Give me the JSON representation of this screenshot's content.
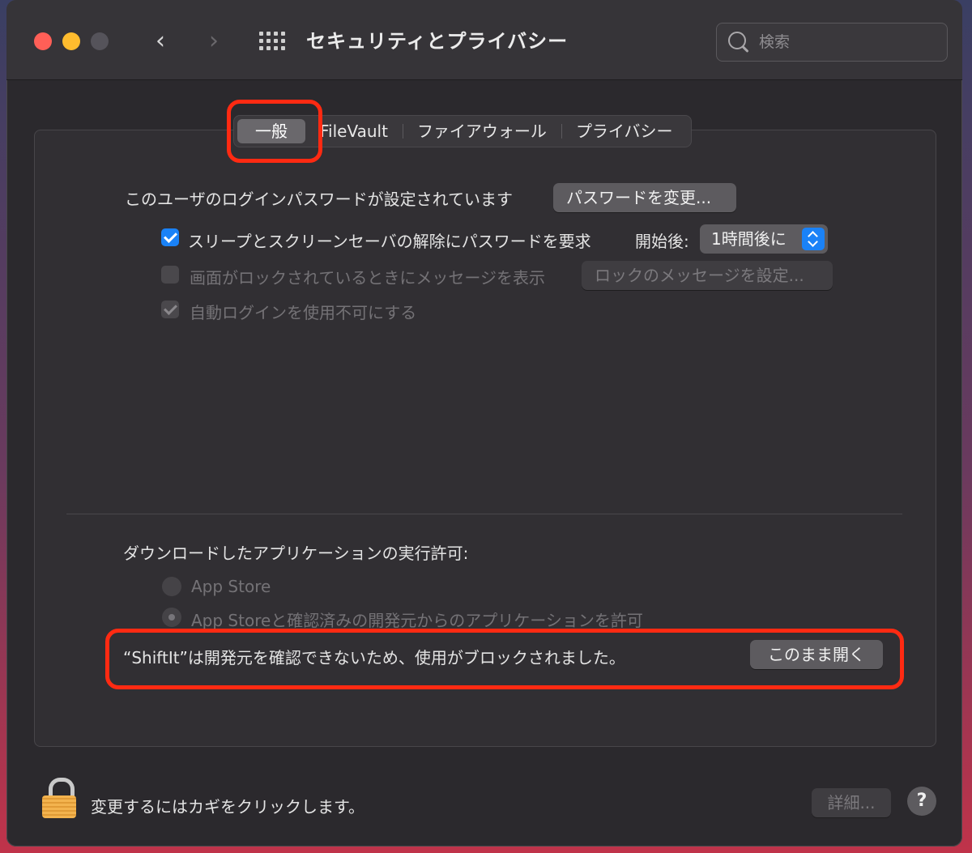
{
  "window": {
    "title": "セキュリティとプライバシー",
    "search_placeholder": "検索"
  },
  "tabs": [
    {
      "label": "一般",
      "selected": true
    },
    {
      "label": "FileVault",
      "selected": false
    },
    {
      "label": "ファイアウォール",
      "selected": false
    },
    {
      "label": "プライバシー",
      "selected": false
    }
  ],
  "general": {
    "password_set_text": "このユーザのログインパスワードが設定されています",
    "change_password_button": "パスワードを変更...",
    "require_password": {
      "label": "スリープとスクリーンセーバの解除にパスワードを要求",
      "checked": true,
      "after_label": "開始後:",
      "after_value": "1時間後に"
    },
    "show_message": {
      "label": "画面がロックされているときにメッセージを表示",
      "checked": false,
      "enabled": false,
      "button": "ロックのメッセージを設定..."
    },
    "disable_auto_login": {
      "label": "自動ログインを使用不可にする",
      "checked": true,
      "enabled": false
    }
  },
  "downloads": {
    "heading": "ダウンロードしたアプリケーションの実行許可:",
    "options": [
      {
        "label": "App Store",
        "selected": false
      },
      {
        "label": "App Storeと確認済みの開発元からのアプリケーションを許可",
        "selected": true
      }
    ],
    "blocked_message": "“ShiftIt”は開発元を確認できないため、使用がブロックされました。",
    "open_anyway_button": "このまま開く"
  },
  "footer": {
    "lock_text": "変更するにはカギをクリックします。",
    "advanced_button": "詳細...",
    "help_label": "?"
  },
  "highlight_color": "#ff2a12",
  "accent_color": "#1a82f7"
}
